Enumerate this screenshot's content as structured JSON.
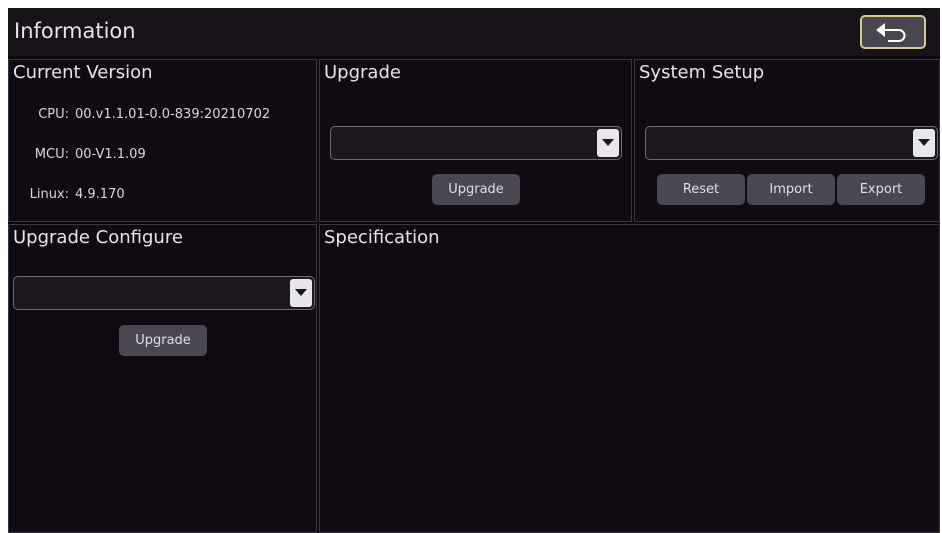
{
  "header": {
    "title": "Information",
    "back_icon": "back-arrow-icon"
  },
  "current_version": {
    "title": "Current Version",
    "rows": [
      {
        "label": "CPU:",
        "value": "00.v1.1.01-0.0-839:20210702"
      },
      {
        "label": "MCU:",
        "value": "00-V1.1.09"
      },
      {
        "label": "Linux:",
        "value": "4.9.170"
      }
    ]
  },
  "upgrade": {
    "title": "Upgrade",
    "select_value": "",
    "button_label": "Upgrade"
  },
  "system_setup": {
    "title": "System Setup",
    "select_value": "",
    "reset_label": "Reset",
    "import_label": "Import",
    "export_label": "Export"
  },
  "upgrade_configure": {
    "title": "Upgrade Configure",
    "select_value": "",
    "button_label": "Upgrade"
  },
  "specification": {
    "title": "Specification"
  },
  "colors": {
    "background": "#0c070d",
    "panel_border": "#3a3540",
    "button": "#4b4752",
    "back_button_border": "#d8c98e"
  }
}
